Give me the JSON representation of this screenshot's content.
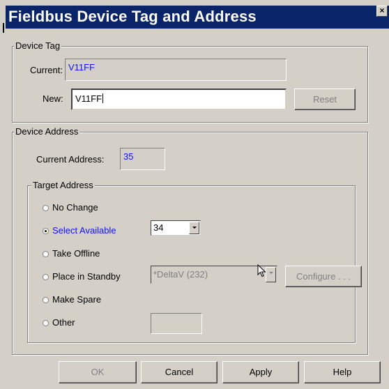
{
  "window": {
    "title": "Fieldbus Device Tag and Address",
    "close_glyph": "×"
  },
  "device_tag": {
    "group_label": "Device Tag",
    "current_label": "Current:",
    "current_value": "V11FF",
    "new_label": "New:",
    "new_value": "V11FF",
    "reset_label": "Reset"
  },
  "device_address": {
    "group_label": "Device Address",
    "current_address_label": "Current Address:",
    "current_address_value": "35",
    "target_address": {
      "group_label": "Target Address",
      "options": [
        {
          "label": "No Change",
          "checked": false
        },
        {
          "label": "Select Available",
          "checked": true
        },
        {
          "label": "Take Offline",
          "checked": false
        },
        {
          "label": "Place in Standby",
          "checked": false
        },
        {
          "label": "Make Spare",
          "checked": false
        },
        {
          "label": "Other",
          "checked": false
        }
      ],
      "available_address": "34",
      "standby_device": "*DeltaV (232)",
      "configure_label": "Configure . . .",
      "other_value": ""
    }
  },
  "buttons": {
    "ok": "OK",
    "cancel": "Cancel",
    "apply": "Apply",
    "help": "Help"
  },
  "colors": {
    "title_bar": "#0a246a",
    "dialog_face": "#d4d0c8",
    "accent_text": "#1010ff"
  }
}
